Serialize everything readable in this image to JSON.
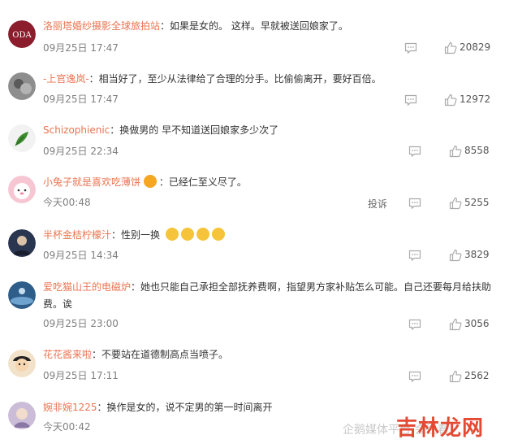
{
  "comments": [
    {
      "user": "洛丽塔婚纱摄影全球旅拍站",
      "text": "：如果是女的。 这样。早就被送回娘家了。",
      "time": "09月25日 17:47",
      "likes": "20829",
      "avatar_color": "#8b1d2c",
      "avatar_letters": "ODA"
    },
    {
      "user": "-上官逸岚-",
      "text": "：相当好了，至少从法律给了合理的分手。比偷偷离开，要好百倍。",
      "time": "09月25日 17:47",
      "likes": "12972",
      "avatar_color": "#6e6e6e"
    },
    {
      "user": "Schizophienic",
      "text": "：换做男的 早不知道送回娘家多少次了",
      "time": "09月25日 22:34",
      "likes": "8558",
      "avatar_color": "#3d8b2f"
    },
    {
      "user": "小兔子就是喜欢吃薄饼",
      "text": "：已经仁至义尽了。",
      "time": "今天00:48",
      "likes": "5255",
      "report": "投诉",
      "avatar_color": "#f2a2b8"
    },
    {
      "user": "半杯金桔柠檬汁",
      "text": "：性别一换",
      "time": "09月25日 14:34",
      "likes": "3829",
      "avatar_color": "#2a3550"
    },
    {
      "user": "爱吃猫山王的电磁炉",
      "text": "：她也只能自己承担全部抚养费啊，指望男方家补贴怎么可能。自己还要每月给扶助费。诶",
      "time": "09月25日 23:00",
      "likes": "3056",
      "avatar_color": "#2e5d8a"
    },
    {
      "user": "花花酱来啦",
      "text": "：不要站在道德制高点当喷子。",
      "time": "09月25日 17:11",
      "likes": "2562",
      "avatar_color": "#e8c9a0"
    },
    {
      "user": "婉非婉1225",
      "text": "：换作是女的，说不定男的第一时间离开",
      "time": "今天00:42",
      "likes": "",
      "avatar_color": "#b8a6c8"
    }
  ],
  "watermark": {
    "source": "企鹅媒体平台 会往看",
    "brand": "吉林龙网"
  },
  "colors": {
    "username": "#eb7350",
    "time": "#808080",
    "icon": "#aaaaaa"
  }
}
